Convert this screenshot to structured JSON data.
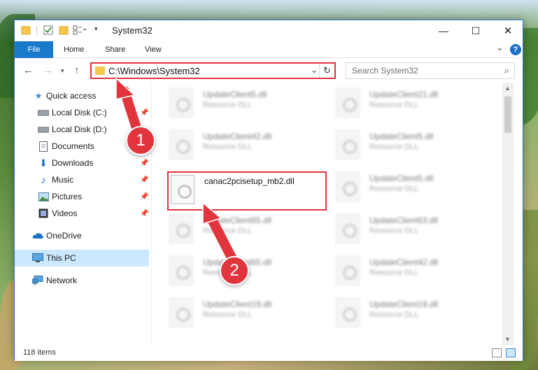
{
  "window": {
    "title": "System32",
    "controls": {
      "minimize": "—",
      "maximize": "☐",
      "close": "✕"
    }
  },
  "ribbon": {
    "tabs": [
      "File",
      "Home",
      "Share",
      "View"
    ],
    "help": "?",
    "collapse": "⌄"
  },
  "address": {
    "path": "C:\\Windows\\System32",
    "search_placeholder": "Search System32"
  },
  "sidebar": {
    "items": [
      {
        "label": "Quick access",
        "icon": "star-icon",
        "pinned": false
      },
      {
        "label": "Local Disk (C:)",
        "icon": "drive-icon",
        "pinned": true
      },
      {
        "label": "Local Disk (D:)",
        "icon": "drive-icon",
        "pinned": false
      },
      {
        "label": "Documents",
        "icon": "documents-icon",
        "pinned": true
      },
      {
        "label": "Downloads",
        "icon": "download-icon",
        "pinned": true
      },
      {
        "label": "Music",
        "icon": "music-icon",
        "pinned": true
      },
      {
        "label": "Pictures",
        "icon": "pictures-icon",
        "pinned": true
      },
      {
        "label": "Videos",
        "icon": "video-icon",
        "pinned": true
      },
      {
        "label": "OneDrive",
        "icon": "cloud-icon",
        "pinned": false
      },
      {
        "label": "This PC",
        "icon": "computer-icon",
        "pinned": false,
        "selected": true
      },
      {
        "label": "Network",
        "icon": "network-icon",
        "pinned": false
      }
    ]
  },
  "files": {
    "left": [
      {
        "name": "UpdateClient5.dll",
        "desc": "Resource DLL"
      },
      {
        "name": "UpdateClient42.dll",
        "desc": "Resource DLL"
      },
      {
        "name": "canac2pcisetup_mb2.dll",
        "desc": ""
      },
      {
        "name": "UpdateClient65.dll",
        "desc": "Resource DLL"
      },
      {
        "name": "UpdateClient65.dll",
        "desc": "Resource DLL"
      },
      {
        "name": "UpdateClient19.dll",
        "desc": "Resource DLL"
      }
    ],
    "right": [
      {
        "name": "UpdateClient21.dll",
        "desc": "Resource DLL"
      },
      {
        "name": "UpdateClient5.dll",
        "desc": "Resource DLL"
      },
      {
        "name": "UpdateClient5.dll",
        "desc": "Resource DLL"
      },
      {
        "name": "UpdateClient63.dll",
        "desc": "Resource DLL"
      },
      {
        "name": "UpdateClient42.dll",
        "desc": "Resource DLL"
      },
      {
        "name": "UpdateClient19.dll",
        "desc": "Resource DLL"
      }
    ]
  },
  "status": {
    "items_count": "118 items"
  },
  "annotations": {
    "step1": "1",
    "step2": "2"
  },
  "colors": {
    "accent": "#1979ca",
    "highlight": "#e0353d",
    "selected": "#cce8ff"
  }
}
